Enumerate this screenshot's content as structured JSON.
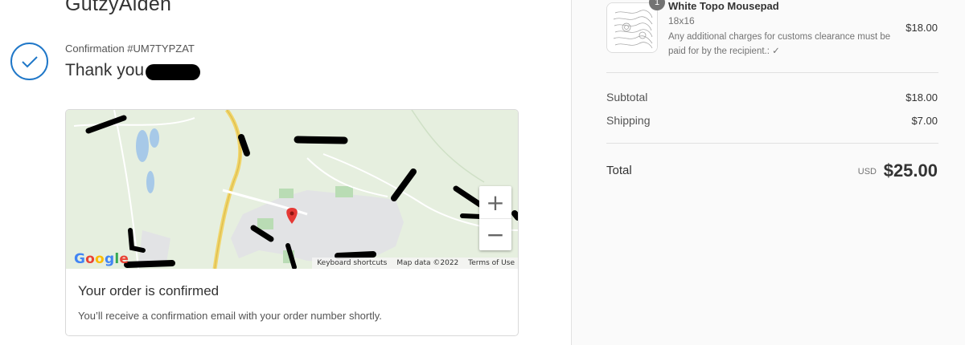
{
  "store": {
    "name": "GutzyAiden"
  },
  "confirmation": {
    "number_label": "Confirmation #UM7TYPZAT",
    "thank_you": "Thank you"
  },
  "map": {
    "zoom_in": "+",
    "zoom_out": "−",
    "logo_text": "Google",
    "footer": {
      "shortcuts": "Keyboard shortcuts",
      "map_data": "Map data ©2022",
      "terms": "Terms of Use"
    }
  },
  "order_status": {
    "title": "Your order is confirmed",
    "subtitle": "You’ll receive a confirmation email with your order number shortly."
  },
  "cart": {
    "item": {
      "quantity": "1",
      "name": "White Topo Mousepad",
      "variant": "18x16",
      "note": "Any additional charges for customs clearance must be paid for by the recipient.: ✓",
      "price": "$18.00"
    },
    "subtotal_label": "Subtotal",
    "subtotal_value": "$18.00",
    "shipping_label": "Shipping",
    "shipping_value": "$7.00",
    "total_label": "Total",
    "total_currency": "USD",
    "total_value": "$25.00"
  },
  "colors": {
    "accent": "#1f77c8",
    "map_green": "#e6efdf",
    "map_road_yellow": "#f0d56a",
    "pin_red": "#e53935"
  }
}
